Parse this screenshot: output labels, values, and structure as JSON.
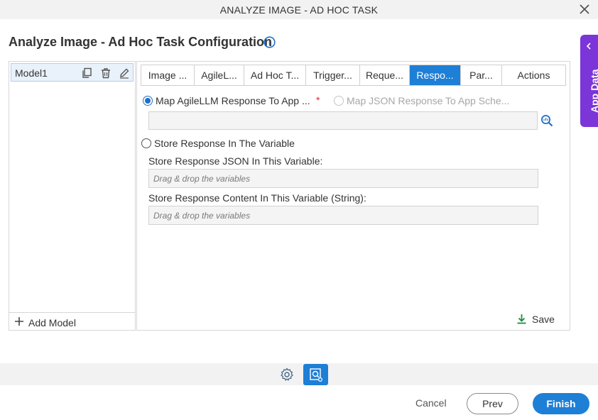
{
  "window": {
    "title": "ANALYZE IMAGE - AD HOC TASK",
    "close_icon": "close-icon"
  },
  "page": {
    "title": "Analyze Image - Ad Hoc Task Configuration",
    "info_icon": "info-icon"
  },
  "app_data": {
    "label": "App Data",
    "icon": "chevron-left-icon",
    "accent": "#7b35d8"
  },
  "models": {
    "items": [
      {
        "label": "Model1"
      }
    ],
    "icons": [
      "copy-icon",
      "trash-icon",
      "edit-icon"
    ],
    "add_label": "Add Model"
  },
  "tabs": [
    {
      "label": "Image ...",
      "active": false
    },
    {
      "label": "AgileL...",
      "active": false
    },
    {
      "label": "Ad Hoc T...",
      "active": false
    },
    {
      "label": "Trigger...",
      "active": false
    },
    {
      "label": "Reque...",
      "active": false
    },
    {
      "label": "Respo...",
      "active": true
    },
    {
      "label": "Par...",
      "active": false
    },
    {
      "label": "Actions",
      "active": false
    }
  ],
  "response": {
    "map_agile_label": "Map AgileLLM Response To App ...",
    "map_agile_required": "*",
    "map_agile_selected": true,
    "map_json_label": "Map JSON Response To App Sche...",
    "map_json_enabled": false,
    "schema_value": "",
    "lookup_icon": "search-icon",
    "store_label": "Store Response In The Variable",
    "store_selected": false,
    "json_var_label": "Store Response JSON In This Variable:",
    "json_var_placeholder": "Drag & drop the variables",
    "content_var_label": "Store Response Content In This Variable (String):",
    "content_var_placeholder": "Drag & drop the variables",
    "save_label": "Save",
    "save_icon": "download-icon"
  },
  "footer": {
    "settings_icon": "gear-icon",
    "image_icon": "image-search-icon",
    "cancel_label": "Cancel",
    "prev_label": "Prev",
    "finish_label": "Finish",
    "accent": "#1e7fd6"
  }
}
